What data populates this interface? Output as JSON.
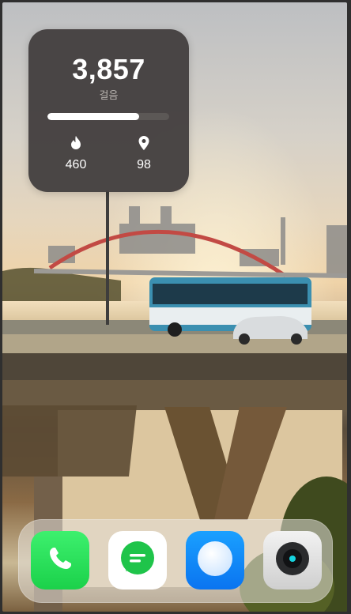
{
  "widget": {
    "steps": "3,857",
    "steps_label": "걸음",
    "progress": 0.75,
    "calories": "460",
    "distance": "98",
    "calorie_icon": "flame-icon",
    "distance_icon": "location-pin-icon"
  },
  "dock": {
    "apps": [
      {
        "name": "phone",
        "icon": "phone-icon",
        "color": "#22d94f"
      },
      {
        "name": "messages",
        "icon": "message-bubble-icon",
        "color": "#1fc44a"
      },
      {
        "name": "browser",
        "icon": "browser-icon",
        "color": "#0d7ff5"
      },
      {
        "name": "camera",
        "icon": "camera-icon",
        "color": "#16d3df"
      }
    ]
  }
}
